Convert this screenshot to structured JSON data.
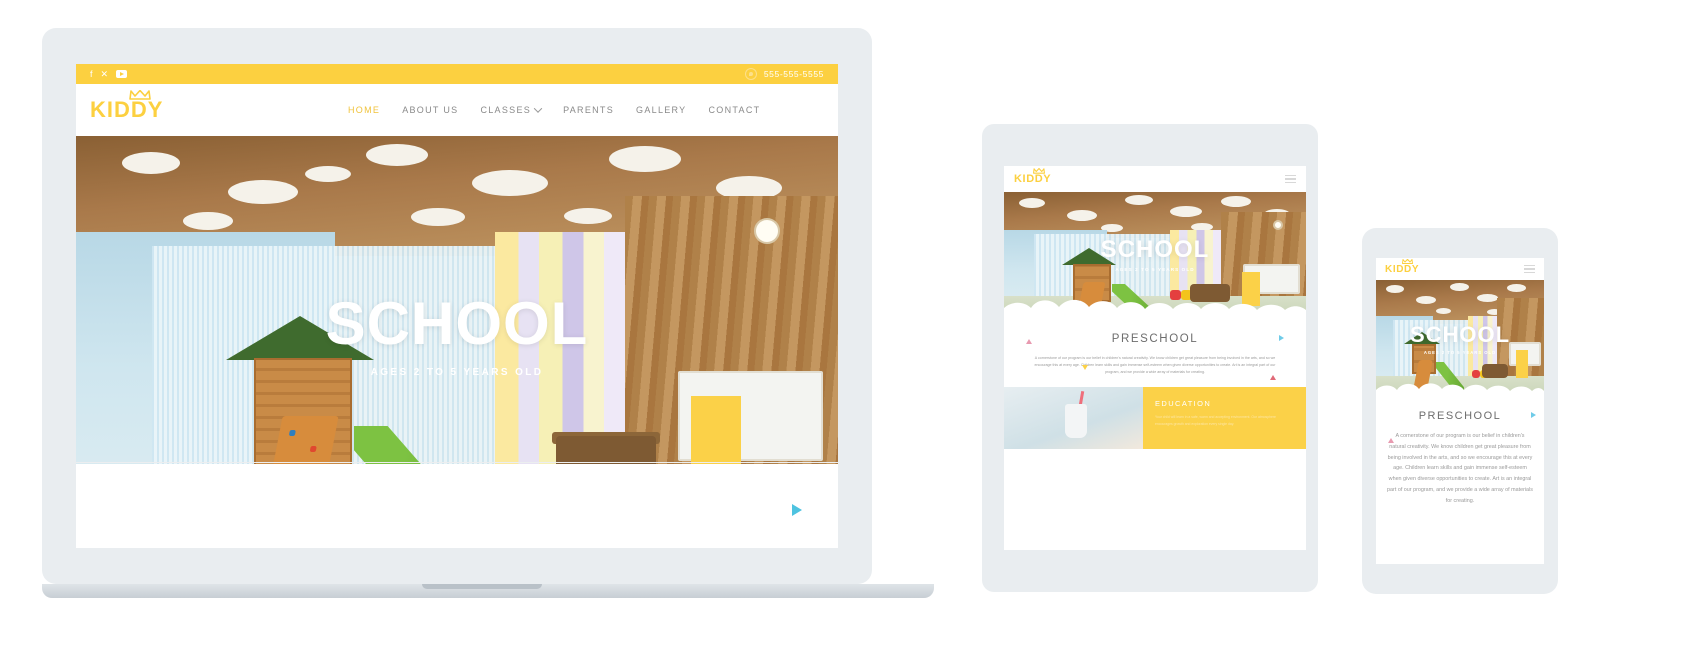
{
  "brand": {
    "logo_text": "KIDDY",
    "accent": "#fcd040",
    "nav_color": "#8a8a8a",
    "active_nav_color": "#f0c33c"
  },
  "topbar": {
    "social": [
      {
        "name": "facebook-icon",
        "glyph": "f"
      },
      {
        "name": "x-twitter-icon",
        "glyph": "✕"
      },
      {
        "name": "youtube-icon",
        "glyph": ""
      }
    ],
    "phone": "555-555-5555"
  },
  "nav": {
    "items": [
      {
        "label": "HOME",
        "active": true,
        "dropdown": false
      },
      {
        "label": "ABOUT US",
        "active": false,
        "dropdown": false
      },
      {
        "label": "CLASSES",
        "active": false,
        "dropdown": true
      },
      {
        "label": "PARENTS",
        "active": false,
        "dropdown": false
      },
      {
        "label": "GALLERY",
        "active": false,
        "dropdown": false
      },
      {
        "label": "CONTACT",
        "active": false,
        "dropdown": false
      }
    ]
  },
  "hero": {
    "title": "SCHOOL",
    "subtitle": "AGES 2 TO 5 YEARS OLD"
  },
  "section": {
    "heading": "PRESCHOOL",
    "body": "A cornerstone of our program is our belief in children's natural creativity. We know children get great pleasure from being involved in the arts, and so we encourage this at every age. Children learn skills and gain immense self-esteem when given diverse opportunities to create. Art is an integral part of our program, and we provide a wide array of materials for creating."
  },
  "card": {
    "title": "EDUCATION",
    "body": "Your child will learn in a safe, warm and accepting environment. Our atmosphere encourages growth and exploration every single day."
  },
  "devices": {
    "laptop_label": "desktop-preview",
    "tablet_label": "tablet-preview",
    "mobile_label": "mobile-preview"
  }
}
